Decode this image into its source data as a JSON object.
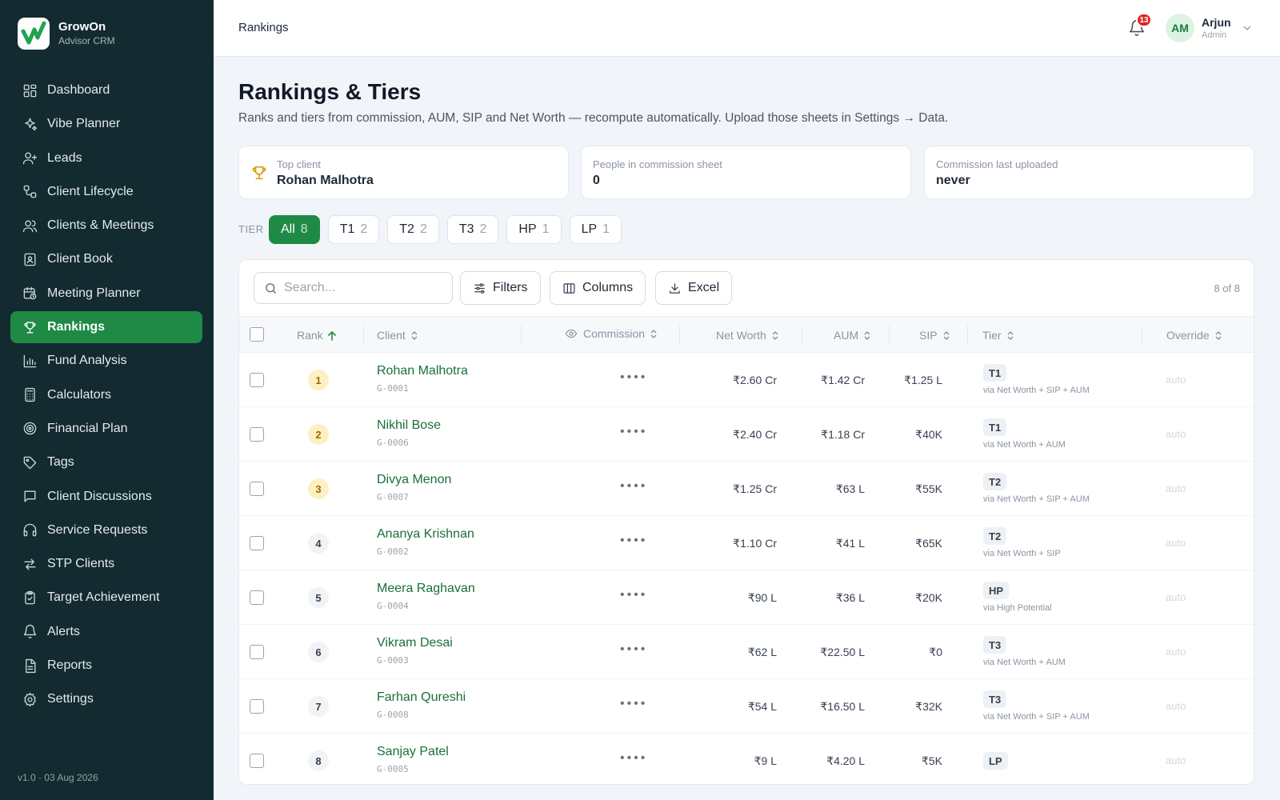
{
  "brand": {
    "name": "GrowOn",
    "subtitle": "Advisor CRM"
  },
  "sidebar": {
    "items": [
      {
        "label": "Dashboard",
        "icon": "dashboard-icon"
      },
      {
        "label": "Vibe Planner",
        "icon": "sparkles-icon"
      },
      {
        "label": "Leads",
        "icon": "user-plus-icon"
      },
      {
        "label": "Client Lifecycle",
        "icon": "lifecycle-icon"
      },
      {
        "label": "Clients & Meetings",
        "icon": "users-icon"
      },
      {
        "label": "Client Book",
        "icon": "book-icon"
      },
      {
        "label": "Meeting Planner",
        "icon": "calendar-clock-icon"
      },
      {
        "label": "Rankings",
        "icon": "trophy-icon",
        "active": true
      },
      {
        "label": "Fund Analysis",
        "icon": "bar-chart-icon"
      },
      {
        "label": "Calculators",
        "icon": "calculator-icon"
      },
      {
        "label": "Financial Plan",
        "icon": "target-icon"
      },
      {
        "label": "Tags",
        "icon": "tag-icon"
      },
      {
        "label": "Client Discussions",
        "icon": "message-icon"
      },
      {
        "label": "Service Requests",
        "icon": "headphones-icon"
      },
      {
        "label": "STP Clients",
        "icon": "arrows-icon"
      },
      {
        "label": "Target Achievement",
        "icon": "clipboard-check-icon"
      },
      {
        "label": "Alerts",
        "icon": "bell-icon"
      },
      {
        "label": "Reports",
        "icon": "file-text-icon"
      },
      {
        "label": "Settings",
        "icon": "gear-icon"
      }
    ],
    "version": "v1.0 · 03 Aug 2026"
  },
  "topbar": {
    "breadcrumb": "Rankings",
    "notifications": "13",
    "user": {
      "initials": "AM",
      "name": "Arjun",
      "role": "Admin"
    }
  },
  "header": {
    "title": "Rankings & Tiers",
    "subtitle": "Ranks and tiers from commission, AUM, SIP and Net Worth — recompute automatically. Upload those sheets in Settings → Data."
  },
  "stats": [
    {
      "label": "Top client",
      "value": "Rohan Malhotra"
    },
    {
      "label": "People in commission sheet",
      "value": "0"
    },
    {
      "label": "Commission last uploaded",
      "value": "never"
    }
  ],
  "tiers": {
    "label": "TIER",
    "chips": [
      {
        "label": "All",
        "count": "8",
        "active": true
      },
      {
        "label": "T1",
        "count": "2"
      },
      {
        "label": "T2",
        "count": "2"
      },
      {
        "label": "T3",
        "count": "2"
      },
      {
        "label": "HP",
        "count": "1"
      },
      {
        "label": "LP",
        "count": "1"
      }
    ]
  },
  "toolbar": {
    "search_placeholder": "Search...",
    "filters_label": "Filters",
    "columns_label": "Columns",
    "excel_label": "Excel",
    "count": "8 of 8"
  },
  "table": {
    "columns": {
      "rank": "Rank",
      "client": "Client",
      "commission": "Commission",
      "net_worth": "Net Worth",
      "aum": "AUM",
      "sip": "SIP",
      "tier": "Tier",
      "override": "Override"
    },
    "rows": [
      {
        "rank": "1",
        "name": "Rohan Malhotra",
        "id": "G-0001",
        "commission": "••••",
        "net_worth": "₹2.60 Cr",
        "aum": "₹1.42 Cr",
        "sip": "₹1.25 L",
        "tier": "T1",
        "via": "via Net Worth + SIP + AUM",
        "override": "auto"
      },
      {
        "rank": "2",
        "name": "Nikhil Bose",
        "id": "G-0006",
        "commission": "••••",
        "net_worth": "₹2.40 Cr",
        "aum": "₹1.18 Cr",
        "sip": "₹40K",
        "tier": "T1",
        "via": "via Net Worth + AUM",
        "override": "auto"
      },
      {
        "rank": "3",
        "name": "Divya Menon",
        "id": "G-0007",
        "commission": "••••",
        "net_worth": "₹1.25 Cr",
        "aum": "₹63 L",
        "sip": "₹55K",
        "tier": "T2",
        "via": "via Net Worth + SIP + AUM",
        "override": "auto"
      },
      {
        "rank": "4",
        "name": "Ananya Krishnan",
        "id": "G-0002",
        "commission": "••••",
        "net_worth": "₹1.10 Cr",
        "aum": "₹41 L",
        "sip": "₹65K",
        "tier": "T2",
        "via": "via Net Worth + SIP",
        "override": "auto"
      },
      {
        "rank": "5",
        "name": "Meera Raghavan",
        "id": "G-0004",
        "commission": "••••",
        "net_worth": "₹90 L",
        "aum": "₹36 L",
        "sip": "₹20K",
        "tier": "HP",
        "via": "via High Potential",
        "override": "auto"
      },
      {
        "rank": "6",
        "name": "Vikram Desai",
        "id": "G-0003",
        "commission": "••••",
        "net_worth": "₹62 L",
        "aum": "₹22.50 L",
        "sip": "₹0",
        "tier": "T3",
        "via": "via Net Worth + AUM",
        "override": "auto"
      },
      {
        "rank": "7",
        "name": "Farhan Qureshi",
        "id": "G-0008",
        "commission": "••••",
        "net_worth": "₹54 L",
        "aum": "₹16.50 L",
        "sip": "₹32K",
        "tier": "T3",
        "via": "via Net Worth + SIP + AUM",
        "override": "auto"
      },
      {
        "rank": "8",
        "name": "Sanjay Patel",
        "id": "G-0005",
        "commission": "••••",
        "net_worth": "₹9 L",
        "aum": "₹4.20 L",
        "sip": "₹5K",
        "tier": "LP",
        "via": "",
        "override": "auto"
      }
    ]
  },
  "colors": {
    "sidebar_bg": "#132a30",
    "accent": "#1f8a45",
    "link": "#1a6f3a"
  }
}
